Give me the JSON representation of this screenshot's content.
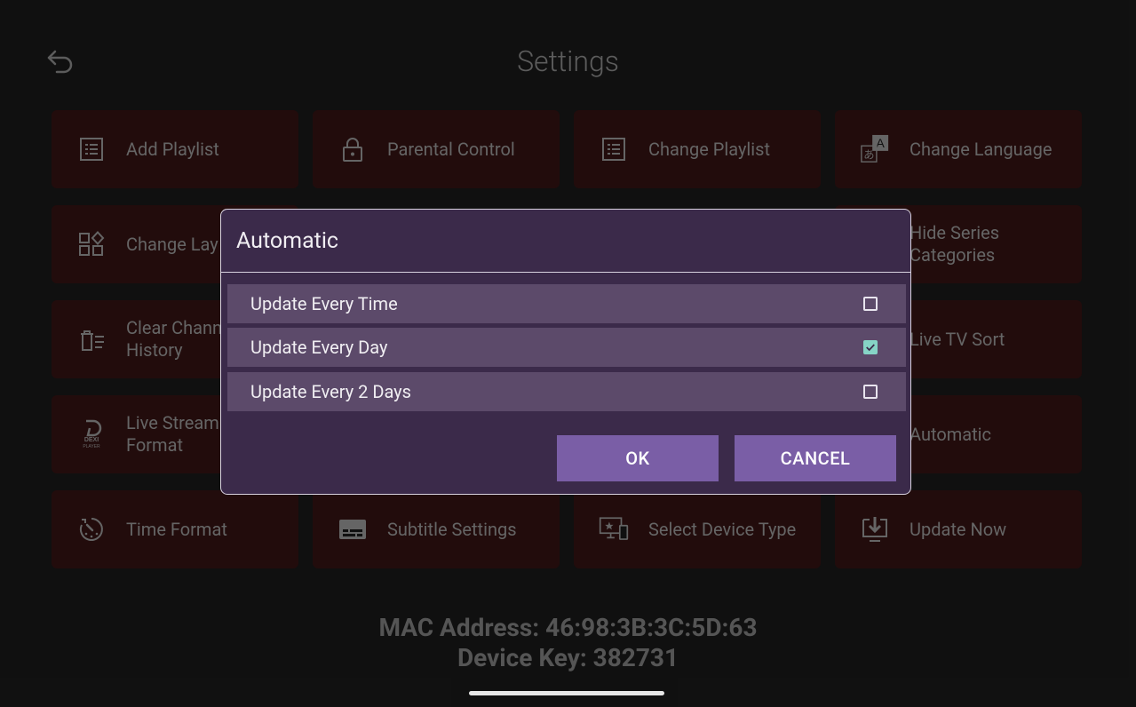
{
  "page": {
    "title": "Settings"
  },
  "tiles": [
    {
      "label": "Add Playlist",
      "icon": "playlist-icon"
    },
    {
      "label": "Parental Control",
      "icon": "lock-icon"
    },
    {
      "label": "Change Playlist",
      "icon": "playlist-icon"
    },
    {
      "label": "Change Language",
      "icon": "language-icon"
    },
    {
      "label": "Change Lay",
      "icon": "layout-icon"
    },
    {
      "label": "Hide Series\nCategories",
      "icon": "hide-icon"
    },
    {
      "label": "Clear Chann\nHistory",
      "icon": "clear-history-icon"
    },
    {
      "label": "Live TV Sort",
      "icon": "sort-icon"
    },
    {
      "label": "Live Stream\nFormat",
      "icon": "dexi-player-icon",
      "icon_text": "DEXI\nPLAYER"
    },
    {
      "label": "Automatic",
      "icon": "auto-icon"
    },
    {
      "label": "Time Format",
      "icon": "time-icon"
    },
    {
      "label": "Subtitle Settings",
      "icon": "subtitle-icon"
    },
    {
      "label": "Select Device Type",
      "icon": "device-icon"
    },
    {
      "label": "Update Now",
      "icon": "download-icon"
    }
  ],
  "footer": {
    "mac": "MAC Address: 46:98:3B:3C:5D:63",
    "device_key": "Device Key: 382731"
  },
  "dialog": {
    "title": "Automatic",
    "options": [
      {
        "label": "Update Every Time",
        "checked": false
      },
      {
        "label": "Update Every Day",
        "checked": true
      },
      {
        "label": "Update Every 2 Days",
        "checked": false
      }
    ],
    "ok_label": "OK",
    "cancel_label": "CANCEL"
  },
  "colors": {
    "tile_bg": "#3a1414",
    "dialog_bg": "#3b2a4a",
    "option_bg": "#5c4a6a",
    "button_bg": "#7a5ea6",
    "check_color": "#86d4c6"
  }
}
